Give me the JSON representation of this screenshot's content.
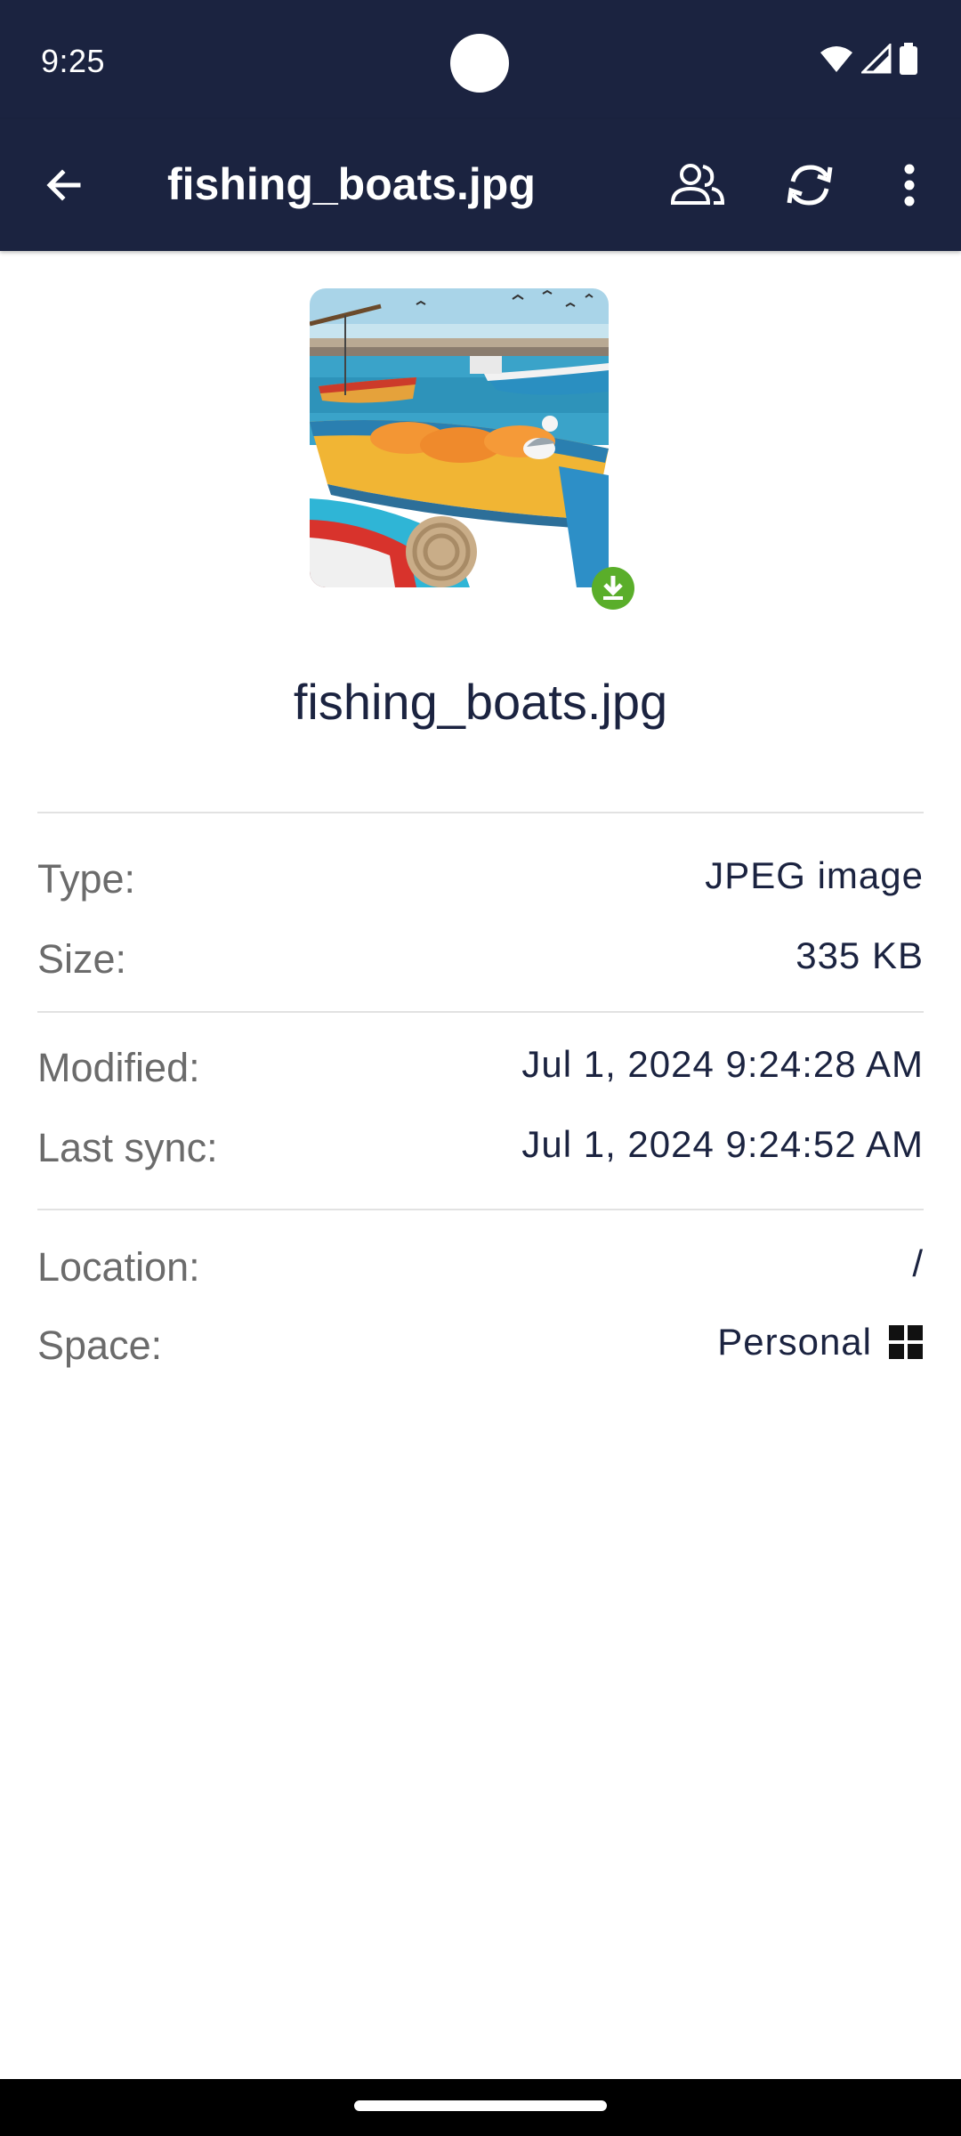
{
  "status_bar": {
    "time": "9:25",
    "icons": [
      "wifi-icon",
      "signal-icon",
      "battery-icon"
    ]
  },
  "app_bar": {
    "title": "fishing_boats.jpg",
    "actions": [
      "share-people-icon",
      "sync-icon",
      "more-vert-icon"
    ]
  },
  "file": {
    "name": "fishing_boats.jpg",
    "thumbnail_alt": "fishing boats harbor photo",
    "badge": "download-icon"
  },
  "details": {
    "type_label": "Type:",
    "type_value": "JPEG image",
    "size_label": "Size:",
    "size_value": "335 KB",
    "modified_label": "Modified:",
    "modified_value": "Jul 1, 2024 9:24:28 AM",
    "last_sync_label": "Last sync:",
    "last_sync_value": "Jul 1, 2024 9:24:52 AM",
    "location_label": "Location:",
    "location_value": "/",
    "space_label": "Space:",
    "space_value": "Personal",
    "space_icon": "grid-icon"
  },
  "colors": {
    "primary_dark": "#1b2340",
    "text_secondary": "#6b6b6b",
    "badge_green": "#5aae2a",
    "divider": "#e2e2e2"
  }
}
